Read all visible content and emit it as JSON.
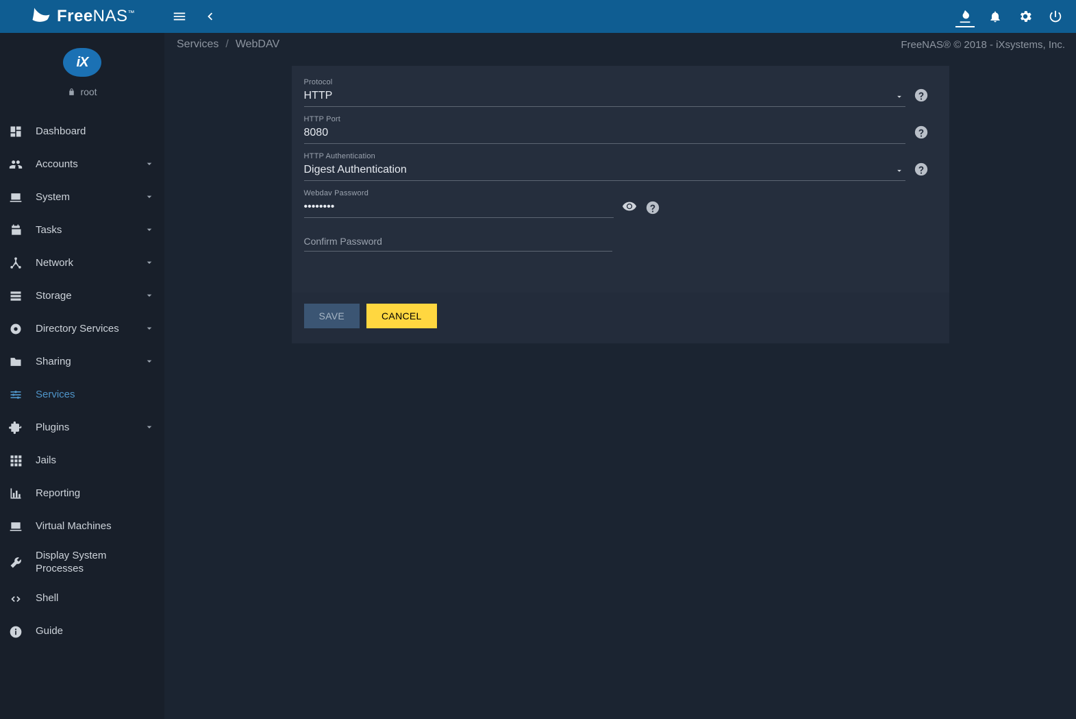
{
  "app": {
    "name_prefix": "Free",
    "name_suffix": "NAS",
    "tm": "™"
  },
  "sidebar": {
    "logo_text": "iX",
    "user": "root",
    "items": [
      {
        "label": "Dashboard",
        "icon": "dashboard",
        "expandable": false
      },
      {
        "label": "Accounts",
        "icon": "people",
        "expandable": true
      },
      {
        "label": "System",
        "icon": "laptop",
        "expandable": true
      },
      {
        "label": "Tasks",
        "icon": "calendar",
        "expandable": true
      },
      {
        "label": "Network",
        "icon": "hub",
        "expandable": true
      },
      {
        "label": "Storage",
        "icon": "storage",
        "expandable": true
      },
      {
        "label": "Directory Services",
        "icon": "dirsvc",
        "expandable": true
      },
      {
        "label": "Sharing",
        "icon": "folder",
        "expandable": true
      },
      {
        "label": "Services",
        "icon": "tune",
        "expandable": false,
        "active": true
      },
      {
        "label": "Plugins",
        "icon": "extension",
        "expandable": true
      },
      {
        "label": "Jails",
        "icon": "apps",
        "expandable": false
      },
      {
        "label": "Reporting",
        "icon": "chart",
        "expandable": false
      },
      {
        "label": "Virtual Machines",
        "icon": "laptop",
        "expandable": false
      },
      {
        "label": "Display System Processes",
        "icon": "build",
        "expandable": false,
        "multiline": true
      },
      {
        "label": "Shell",
        "icon": "code",
        "expandable": false
      },
      {
        "label": "Guide",
        "icon": "info",
        "expandable": false
      }
    ]
  },
  "breadcrumb": {
    "parent": "Services",
    "current": "WebDAV"
  },
  "copyright": "FreeNAS® © 2018 - iXsystems, Inc.",
  "form": {
    "protocol": {
      "label": "Protocol",
      "value": "HTTP"
    },
    "http_port": {
      "label": "HTTP Port",
      "value": "8080"
    },
    "http_auth": {
      "label": "HTTP Authentication",
      "value": "Digest Authentication"
    },
    "password": {
      "label": "Webdav Password",
      "value": "••••••••"
    },
    "confirm": {
      "label": "Confirm Password"
    }
  },
  "buttons": {
    "save": "SAVE",
    "cancel": "CANCEL"
  }
}
